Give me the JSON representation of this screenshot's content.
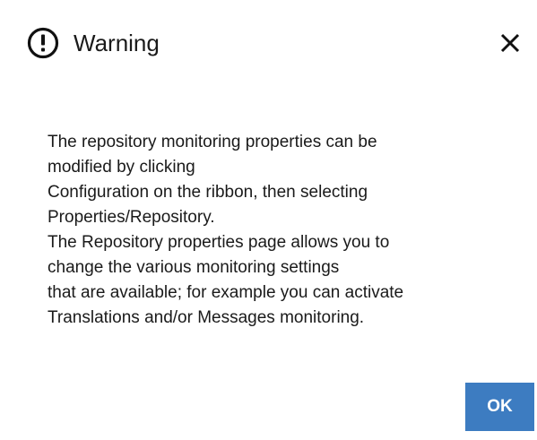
{
  "dialog": {
    "title": "Warning",
    "icon": "exclamation-circle-icon",
    "close_icon": "close-icon",
    "message_lines": [
      "The repository monitoring properties can be",
      "modified by clicking",
      "Configuration on the ribbon, then selecting",
      "Properties/Repository.",
      "The Repository properties page allows you to",
      "change the various monitoring settings",
      "that are available; for example you can activate",
      "Translations and/or Messages monitoring."
    ],
    "ok_label": "OK"
  },
  "colors": {
    "ok_button_bg": "#3d7cc1",
    "ok_button_text": "#ffffff",
    "text": "#1a1a1a",
    "background": "#ffffff"
  }
}
